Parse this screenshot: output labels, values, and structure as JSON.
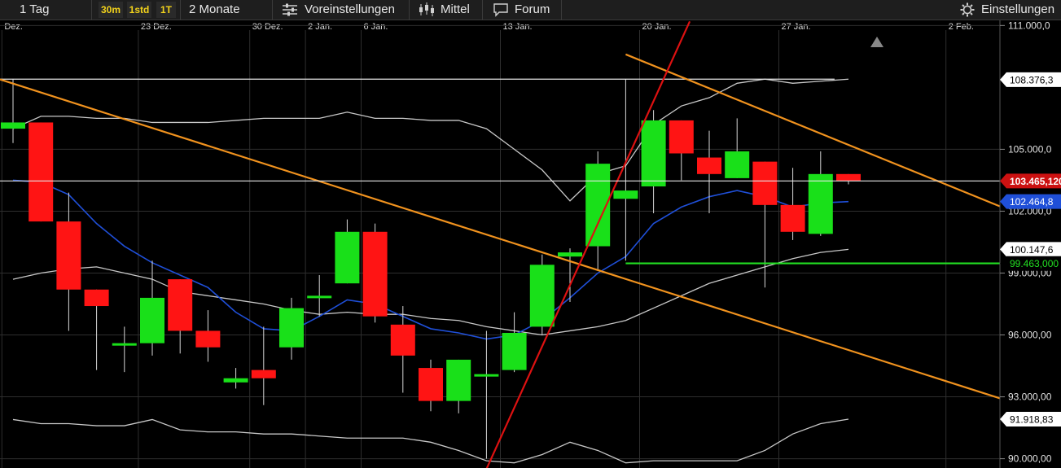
{
  "toolbar": {
    "period": "1 Tag",
    "intervals": [
      "30m",
      "1std",
      "1T"
    ],
    "range": "2 Monate",
    "presets": "Voreinstellungen",
    "average": "Mittel",
    "forum": "Forum",
    "settings": "Einstellungen",
    "icons": [
      "sliders-icon",
      "candlestick-icon",
      "chat-bubble-icon",
      "gear-icon"
    ]
  },
  "chart_data": {
    "type": "candlestick",
    "grid": true,
    "colors": {
      "up": "#19e019",
      "down": "#ff1414",
      "trendline": "#f0921e",
      "steep_trendline": "#dd1111",
      "bollinger": "#c8c8c8",
      "moving_average": "#1f4fd8",
      "support": "#22e022",
      "background": "#000000"
    },
    "x_tick_labels": [
      "Dez.",
      "23 Dez.",
      "30 Dez.",
      "2 Jan.",
      "6 Jan.",
      "13 Jan.",
      "20 Jan.",
      "27 Jan.",
      "2 Feb."
    ],
    "x_ticks": [
      {
        "label": "Dez.",
        "c": -0.4
      },
      {
        "label": "23 Dez.",
        "c": 4.5
      },
      {
        "label": "30 Dez.",
        "c": 8.5
      },
      {
        "label": "2 Jan.",
        "c": 10.5
      },
      {
        "label": "6 Jan.",
        "c": 12.5
      },
      {
        "label": "13 Jan.",
        "c": 17.5
      },
      {
        "label": "20 Jan.",
        "c": 22.5
      },
      {
        "label": "27 Jan.",
        "c": 27.5
      },
      {
        "label": "2 Feb.",
        "c": 33.5
      }
    ],
    "y_ticks": [
      {
        "label": "111.000,0",
        "value": 111000
      },
      {
        "label": "105.000,0",
        "value": 105000
      },
      {
        "label": "102.000,0",
        "value": 102000
      },
      {
        "label": "99.000,00",
        "value": 99000
      },
      {
        "label": "96.000,00",
        "value": 96000
      },
      {
        "label": "93.000,00",
        "value": 93000
      },
      {
        "label": "90.000,00",
        "value": 90000
      }
    ],
    "ylim": [
      89550,
      111250
    ],
    "price_labels": [
      {
        "label": "108.376,3",
        "value": 108376,
        "style": "white"
      },
      {
        "label": "103.465,120",
        "value": 103465,
        "style": "red"
      },
      {
        "label": "102.464,8",
        "value": 102464,
        "style": "blue"
      },
      {
        "label": "100.147,6",
        "value": 100147,
        "style": "white"
      },
      {
        "label": "99.463,000",
        "value": 99463,
        "style": "green"
      },
      {
        "label": "91.918,83",
        "value": 91918,
        "style": "white"
      }
    ],
    "candles": [
      {
        "o": 106000,
        "h": 108400,
        "l": 105300,
        "c": 106300
      },
      {
        "o": 106300,
        "h": 106300,
        "l": 101500,
        "c": 101500
      },
      {
        "o": 101500,
        "h": 102900,
        "l": 96200,
        "c": 98200
      },
      {
        "o": 98200,
        "h": 98200,
        "l": 94300,
        "c": 97400
      },
      {
        "o": 95600,
        "h": 96400,
        "l": 94200,
        "c": 95600
      },
      {
        "o": 95600,
        "h": 99600,
        "l": 95000,
        "c": 97800
      },
      {
        "o": 98700,
        "h": 98700,
        "l": 95100,
        "c": 96200
      },
      {
        "o": 96200,
        "h": 97200,
        "l": 94700,
        "c": 95400
      },
      {
        "o": 93700,
        "h": 94400,
        "l": 93400,
        "c": 93900
      },
      {
        "o": 94300,
        "h": 96400,
        "l": 92600,
        "c": 93900
      },
      {
        "o": 95400,
        "h": 97800,
        "l": 94800,
        "c": 97300
      },
      {
        "o": 97900,
        "h": 98900,
        "l": 96900,
        "c": 97900
      },
      {
        "o": 98500,
        "h": 101600,
        "l": 98500,
        "c": 101000
      },
      {
        "o": 101000,
        "h": 101400,
        "l": 96600,
        "c": 96900
      },
      {
        "o": 96500,
        "h": 97400,
        "l": 93200,
        "c": 95000
      },
      {
        "o": 94400,
        "h": 94800,
        "l": 92300,
        "c": 92800
      },
      {
        "o": 92800,
        "h": 94800,
        "l": 92200,
        "c": 94800
      },
      {
        "o": 94100,
        "h": 96200,
        "l": 90000,
        "c": 94100
      },
      {
        "o": 94300,
        "h": 97100,
        "l": 94200,
        "c": 96100
      },
      {
        "o": 96400,
        "h": 99900,
        "l": 96000,
        "c": 99400
      },
      {
        "o": 99800,
        "h": 100200,
        "l": 97600,
        "c": 100000
      },
      {
        "o": 100300,
        "h": 104900,
        "l": 99100,
        "c": 104300
      },
      {
        "o": 102600,
        "h": 108400,
        "l": 99600,
        "c": 103000
      },
      {
        "o": 103200,
        "h": 106900,
        "l": 101900,
        "c": 106400
      },
      {
        "o": 106400,
        "h": 106400,
        "l": 103500,
        "c": 104800
      },
      {
        "o": 104600,
        "h": 105900,
        "l": 101900,
        "c": 103800
      },
      {
        "o": 103600,
        "h": 106500,
        "l": 103600,
        "c": 104900
      },
      {
        "o": 104400,
        "h": 104400,
        "l": 98300,
        "c": 102300
      },
      {
        "o": 102300,
        "h": 104100,
        "l": 100600,
        "c": 101000
      },
      {
        "o": 100900,
        "h": 104900,
        "l": 100800,
        "c": 103800
      },
      {
        "o": 103800,
        "h": 103800,
        "l": 103300,
        "c": 103465
      }
    ],
    "moving_average": [
      103500,
      103400,
      102800,
      101400,
      100300,
      99500,
      98900,
      98300,
      97100,
      96300,
      96200,
      96900,
      97700,
      97500,
      96900,
      96300,
      96100,
      95800,
      96000,
      96700,
      97800,
      99000,
      99800,
      101400,
      102200,
      102700,
      103000,
      102700,
      102200,
      102400,
      102464
    ],
    "bollinger_upper": [
      106000,
      106600,
      106600,
      106500,
      106500,
      106300,
      106300,
      106300,
      106400,
      106500,
      106500,
      106500,
      106800,
      106500,
      106500,
      106400,
      106400,
      106000,
      105000,
      104000,
      102500,
      103800,
      104200,
      106200,
      107100,
      107500,
      108200,
      108400,
      108200,
      108300,
      108400
    ],
    "bollinger_lower": [
      98700,
      99000,
      99200,
      99300,
      99000,
      98700,
      98100,
      97900,
      97700,
      97500,
      97200,
      97000,
      97100,
      97000,
      97000,
      96800,
      96700,
      96400,
      96200,
      96000,
      96200,
      96400,
      96700,
      97300,
      97900,
      98500,
      98900,
      99300,
      99700,
      100000,
      100147
    ],
    "bollinger_lower_outer": [
      91900,
      91700,
      91700,
      91600,
      91600,
      91900,
      91400,
      91300,
      91300,
      91200,
      91200,
      91100,
      91000,
      91000,
      91000,
      90800,
      90400,
      89900,
      89800,
      90200,
      90800,
      90400,
      89800,
      89900,
      89900,
      89900,
      89900,
      90400,
      91200,
      91700,
      91918
    ],
    "trendlines": [
      {
        "name": "upper-horizontal",
        "style": "white",
        "points": [
          [
            -0.5,
            108400
          ],
          [
            29.5,
            108400
          ]
        ]
      },
      {
        "name": "main-downtrend",
        "style": "orange",
        "points": [
          [
            -0.5,
            108400
          ],
          [
            35.5,
            92900
          ]
        ]
      },
      {
        "name": "secondary-downtrend",
        "style": "orange",
        "points": [
          [
            22,
            109600
          ],
          [
            35.5,
            102200
          ]
        ]
      },
      {
        "name": "steep-uptrend",
        "style": "red",
        "points": [
          [
            17,
            89500
          ],
          [
            24.3,
            111200
          ]
        ]
      },
      {
        "name": "support",
        "style": "green",
        "points": [
          [
            22,
            99470
          ],
          [
            36.5,
            99470
          ]
        ]
      },
      {
        "name": "last-price",
        "style": "white",
        "points": [
          [
            -0.5,
            103465
          ],
          [
            36.5,
            103465
          ]
        ]
      }
    ]
  }
}
